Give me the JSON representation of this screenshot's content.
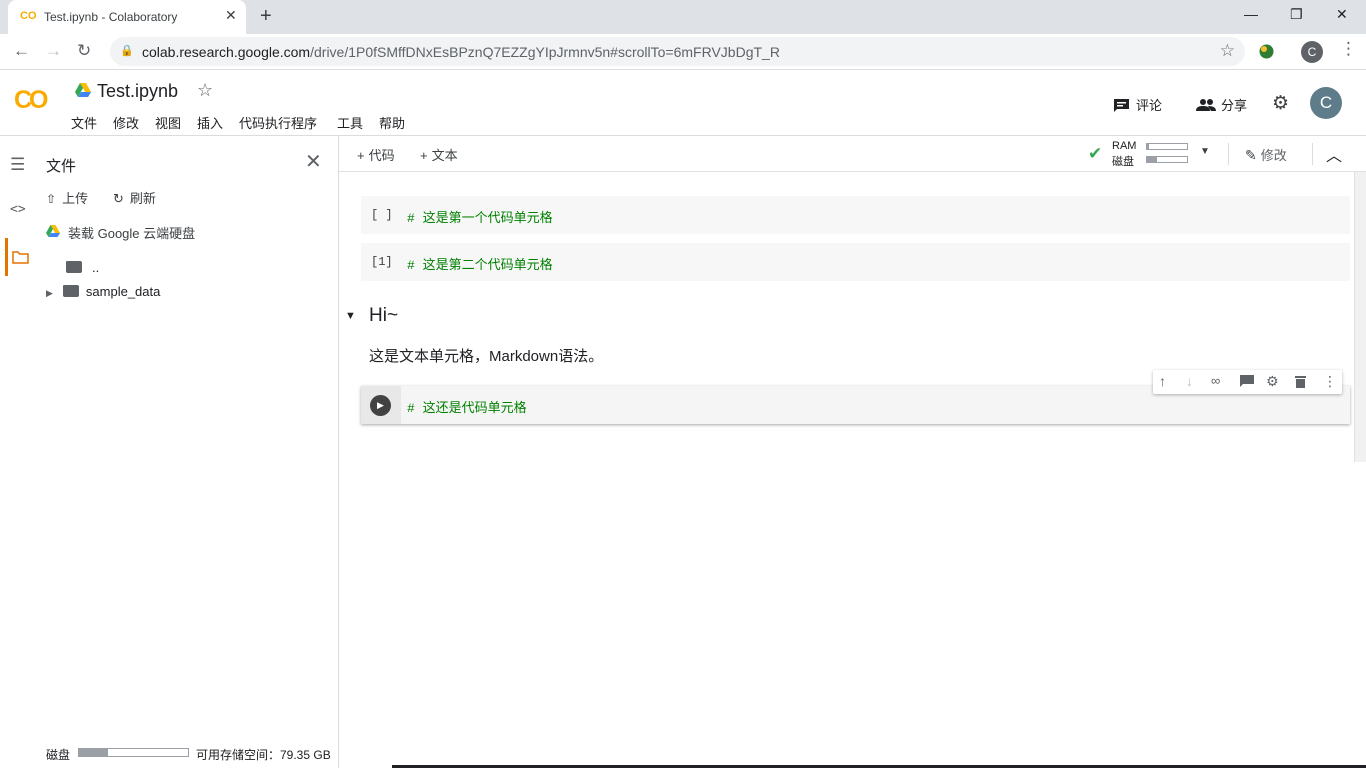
{
  "browser": {
    "tab_title": "Test.ipynb - Colaboratory",
    "tab_favicon": "CO",
    "url_host": "colab.research.google.com",
    "url_path": "/drive/1P0fSMffDNxEsBPznQ7EZZgYIpJrmnv5n#scrollTo=6mFRVJbDgT_R",
    "profile_initial": "C"
  },
  "header": {
    "logo": "CO",
    "notebook_title": "Test.ipynb",
    "menu": [
      "文件",
      "修改",
      "视图",
      "插入",
      "代码执行程序",
      "工具",
      "帮助"
    ],
    "comment_label": "评论",
    "share_label": "分享",
    "user_initial": "C"
  },
  "sidepanel": {
    "title": "文件",
    "upload_label": "上传",
    "refresh_label": "刷新",
    "mount_label": "装载 Google 云端硬盘",
    "tree": [
      {
        "label": ".."
      },
      {
        "label": "sample_data"
      }
    ],
    "disk_label": "磁盘",
    "disk_used_fraction": 0.27,
    "disk_free_text": "可用存储空间：79.35 GB"
  },
  "nb_toolbar": {
    "add_code_label": "代码",
    "add_text_label": "文本",
    "ram_label": "RAM",
    "disk_label": "磁盘",
    "ram_fraction": 0.05,
    "disk_fraction": 0.25,
    "edit_label": "修改"
  },
  "cells": [
    {
      "prompt": "[ ]",
      "code": "#  这是第一个代码单元格"
    },
    {
      "prompt": "[1]",
      "code": "#  这是第二个代码单元格"
    },
    {
      "heading": "Hi~",
      "text": "这是文本单元格，Markdown语法。"
    },
    {
      "code": "#  这还是代码单元格"
    }
  ],
  "colors": {
    "accent": "#e37400",
    "logo": "#f9ab00",
    "code_comment": "#008000",
    "ok_check": "#34a853"
  }
}
